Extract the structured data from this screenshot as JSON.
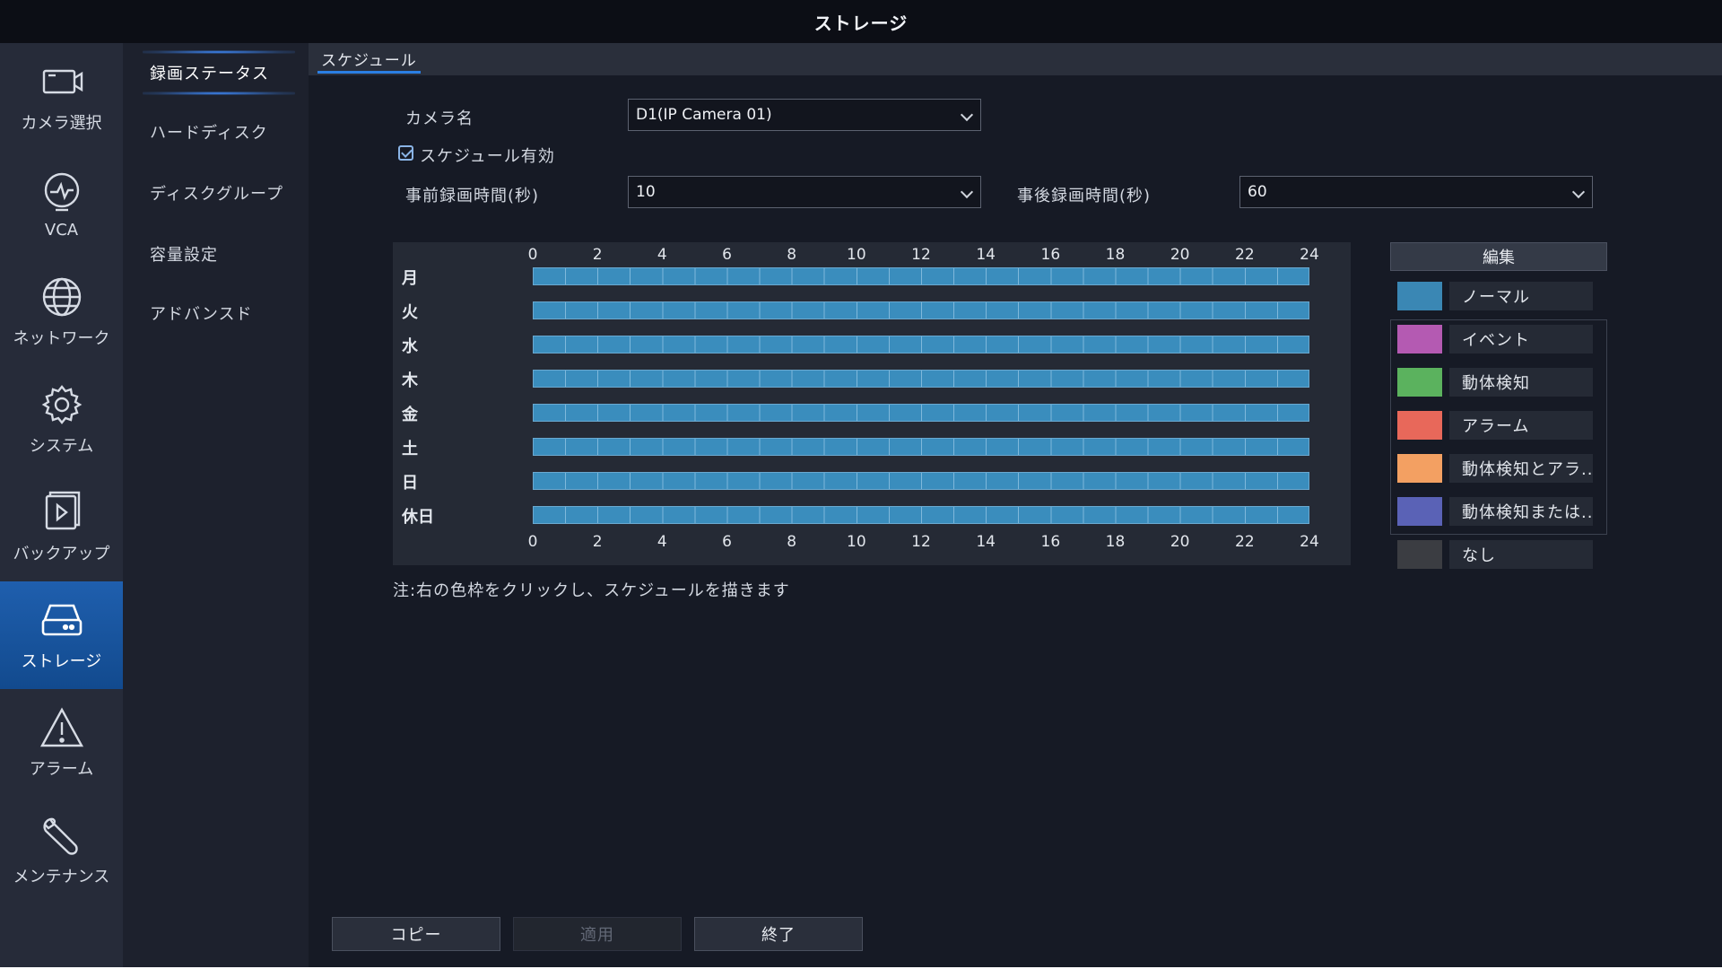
{
  "window": {
    "title": "ストレージ"
  },
  "nav": {
    "items": [
      {
        "id": "camera",
        "label": "カメラ選択",
        "icon": "camera-icon",
        "active": false
      },
      {
        "id": "vca",
        "label": "VCA",
        "icon": "vca-icon",
        "active": false
      },
      {
        "id": "network",
        "label": "ネットワーク",
        "icon": "globe-icon",
        "active": false
      },
      {
        "id": "system",
        "label": "システム",
        "icon": "gear-icon",
        "active": false
      },
      {
        "id": "backup",
        "label": "バックアップ",
        "icon": "backup-icon",
        "active": false
      },
      {
        "id": "storage",
        "label": "ストレージ",
        "icon": "hdd-icon",
        "active": true
      },
      {
        "id": "alarm",
        "label": "アラーム",
        "icon": "warning-icon",
        "active": false
      },
      {
        "id": "maintenance",
        "label": "メンテナンス",
        "icon": "wrench-icon",
        "active": false
      }
    ]
  },
  "submenu": {
    "items": [
      {
        "label": "録画ステータス",
        "active": true
      },
      {
        "label": "ハードディスク",
        "active": false
      },
      {
        "label": "ディスクグループ",
        "active": false
      },
      {
        "label": "容量設定",
        "active": false
      },
      {
        "label": "アドバンスド",
        "active": false
      }
    ]
  },
  "tabs": [
    {
      "label": "スケジュール",
      "active": true
    }
  ],
  "form": {
    "camera_label": "カメラ名",
    "camera_value": "D1(IP Camera 01)",
    "schedule_enabled_label": "スケジュール有効",
    "schedule_enabled": true,
    "pre_record_label": "事前録画時間(秒)",
    "pre_record_value": "10",
    "post_record_label": "事後録画時間(秒)",
    "post_record_value": "60"
  },
  "schedule": {
    "hours": [
      "0",
      "2",
      "4",
      "6",
      "8",
      "10",
      "12",
      "14",
      "16",
      "18",
      "20",
      "22",
      "24"
    ],
    "days": [
      "月",
      "火",
      "水",
      "木",
      "金",
      "土",
      "日",
      "休日"
    ],
    "day_fill_type": [
      "normal",
      "normal",
      "normal",
      "normal",
      "normal",
      "normal",
      "normal",
      "normal"
    ],
    "note": "注:右の色枠をクリックし、スケジュールを描きます"
  },
  "legend": {
    "edit_label": "編集",
    "items": [
      {
        "label": "ノーマル",
        "color": "#3a87b4"
      },
      {
        "label": "イベント",
        "color": "#b45ab2"
      },
      {
        "label": "動体検知",
        "color": "#5bb25e"
      },
      {
        "label": "アラーム",
        "color": "#e8685a"
      },
      {
        "label": "動体検知とアラ...",
        "color": "#f3a062"
      },
      {
        "label": "動体検知または...",
        "color": "#5a62b6"
      },
      {
        "label": "なし",
        "color": "#3b3d42"
      }
    ]
  },
  "buttons": {
    "copy": "コピー",
    "apply": "適用",
    "exit": "終了"
  }
}
